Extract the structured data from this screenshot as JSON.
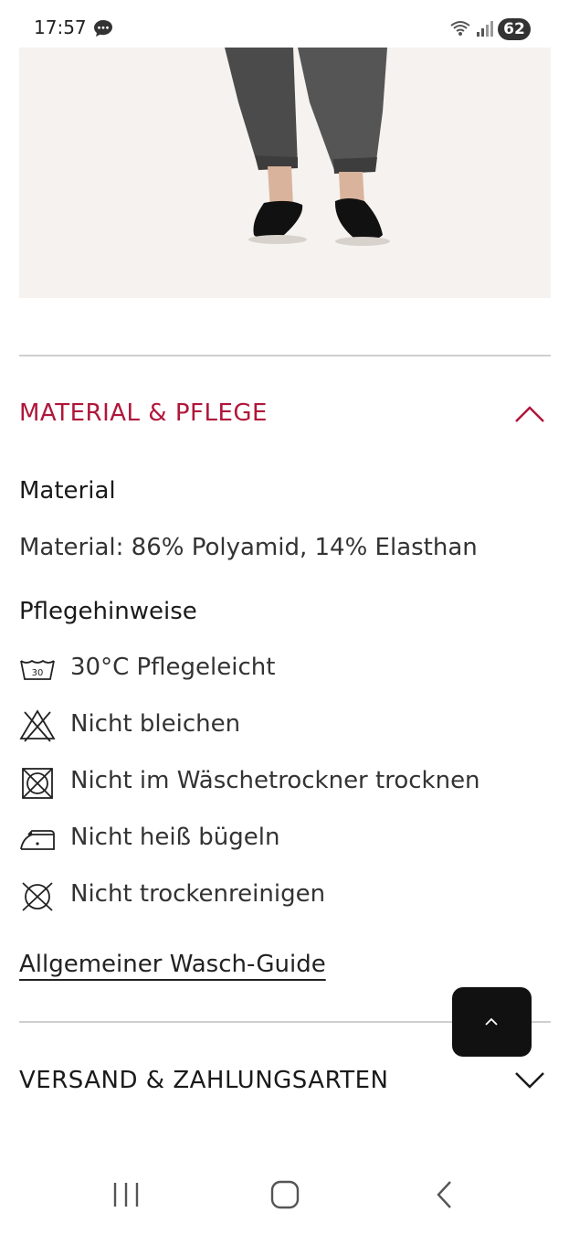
{
  "status_bar": {
    "time": "17:57",
    "battery": "62",
    "icons": [
      "message-icon",
      "wifi-icon",
      "signal-icon",
      "battery-icon"
    ]
  },
  "product_image": {
    "description_icon": "product-photo"
  },
  "accordion_material": {
    "title": "MATERIAL & PFLEGE",
    "expanded": true,
    "material_heading": "Material",
    "material_text": "Material: 86% Polyamid, 14% Elasthan",
    "care_heading": "Pflegehinweise",
    "care_items": [
      {
        "icon": "wash-30-icon",
        "label": "30°C Pflegeleicht",
        "icon_text": "30"
      },
      {
        "icon": "no-bleach-icon",
        "label": "Nicht bleichen"
      },
      {
        "icon": "no-tumble-dry-icon",
        "label": "Nicht im Wäschetrockner trocknen"
      },
      {
        "icon": "iron-low-icon",
        "label": "Nicht heiß bügeln"
      },
      {
        "icon": "no-dry-clean-icon",
        "label": "Nicht trockenreinigen"
      }
    ],
    "guide_link": "Allgemeiner Wasch-Guide"
  },
  "accordion_shipping": {
    "title": "VERSAND & ZAHLUNGSARTEN",
    "expanded": false
  },
  "colors": {
    "accent": "#b0163a",
    "text": "#1a1a1a",
    "divider": "#cfcfcf",
    "scroll_button": "#111111"
  }
}
